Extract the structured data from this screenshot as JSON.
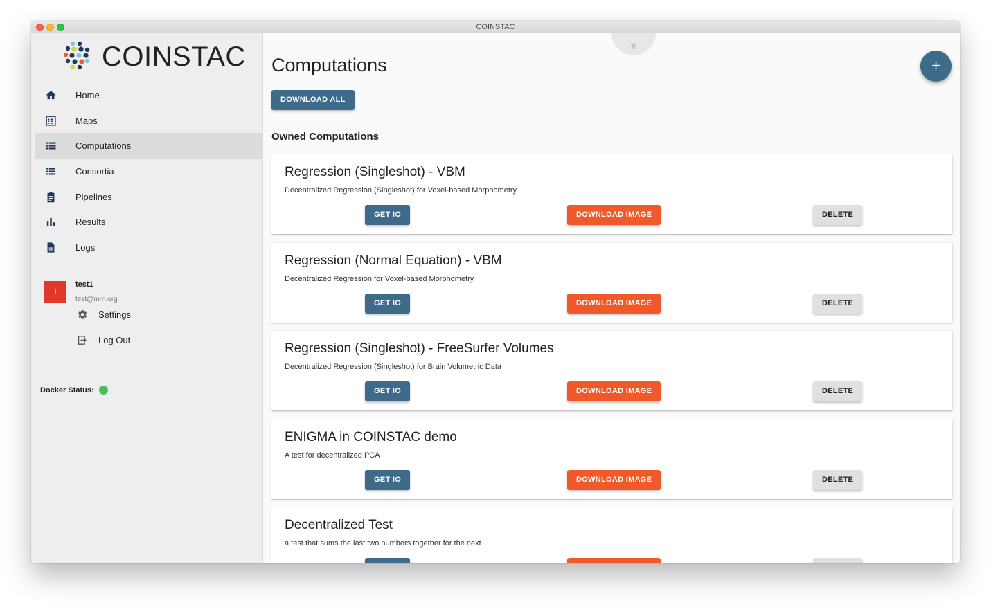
{
  "window": {
    "title": "COINSTAC"
  },
  "app": {
    "name": "COINSTAC"
  },
  "sidebar": {
    "items": [
      {
        "label": "Home",
        "icon": "home-icon",
        "active": false
      },
      {
        "label": "Maps",
        "icon": "maps-icon",
        "active": false
      },
      {
        "label": "Computations",
        "icon": "computations-icon",
        "active": true
      },
      {
        "label": "Consortia",
        "icon": "consortia-icon",
        "active": false
      },
      {
        "label": "Pipelines",
        "icon": "pipelines-icon",
        "active": false
      },
      {
        "label": "Results",
        "icon": "results-icon",
        "active": false
      },
      {
        "label": "Logs",
        "icon": "logs-icon",
        "active": false
      }
    ],
    "user": {
      "initial": "T",
      "name": "test1",
      "email": "test@mrn.org",
      "settings_label": "Settings",
      "logout_label": "Log Out"
    },
    "docker": {
      "label": "Docker Status:",
      "status_color": "#4fbe5a"
    }
  },
  "main": {
    "title": "Computations",
    "fab_label": "+",
    "download_all_label": "DOWNLOAD ALL",
    "section_title": "Owned Computations",
    "cards": [
      {
        "title": "Regression (Singleshot) - VBM",
        "description": "Decentralized Regression (Singleshot) for Voxel-based Morphometry"
      },
      {
        "title": "Regression (Normal Equation) - VBM",
        "description": "Decentralized Regression for Voxel-based Morphometry"
      },
      {
        "title": "Regression (Singleshot) - FreeSurfer Volumes",
        "description": "Decentralized Regression (Singleshot) for Brain Volumetric Data"
      },
      {
        "title": "ENIGMA in COINSTAC demo",
        "description": "A test for decentralized PCA"
      },
      {
        "title": "Decentralized Test",
        "description": "a test that sums the last two numbers together for the next"
      }
    ],
    "card_buttons": {
      "get_io": "GET IO",
      "download_image": "DOWNLOAD IMAGE",
      "delete": "DELETE"
    }
  },
  "colors": {
    "primary": "#3e6b8a",
    "accent": "#f05a2a",
    "avatar": "#e0392b"
  }
}
